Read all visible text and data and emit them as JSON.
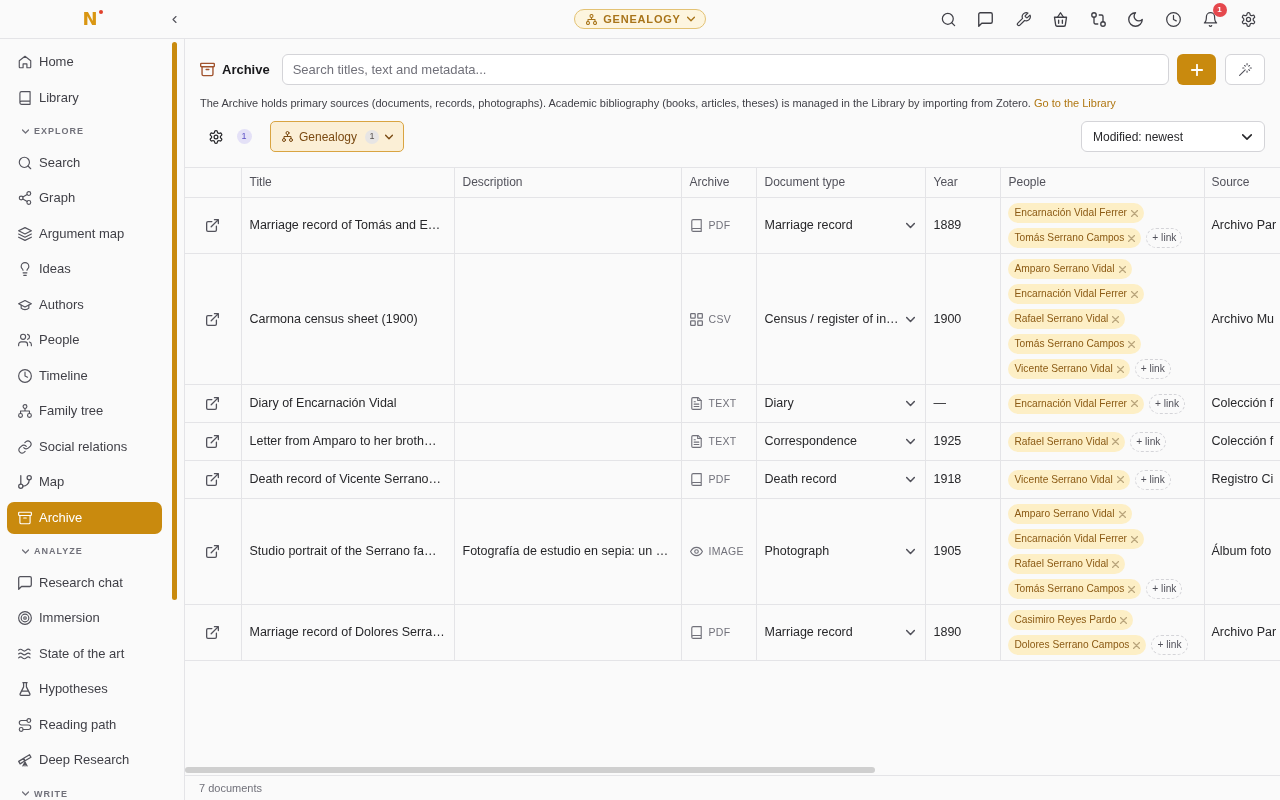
{
  "app": {
    "logo": "N",
    "workspace": "GENEALOGY",
    "notifications": "1"
  },
  "sidebar": {
    "sections": [
      {
        "items": [
          {
            "label": "Home",
            "selected": false
          },
          {
            "label": "Library",
            "selected": false
          }
        ]
      },
      {
        "heading": "EXPLORE",
        "expanded": true,
        "items": [
          {
            "label": "Search",
            "selected": false
          },
          {
            "label": "Graph",
            "selected": false
          },
          {
            "label": "Argument map",
            "selected": false
          },
          {
            "label": "Ideas",
            "selected": false
          },
          {
            "label": "Authors",
            "selected": false
          },
          {
            "label": "People",
            "selected": false
          },
          {
            "label": "Timeline",
            "selected": false
          },
          {
            "label": "Family tree",
            "selected": false
          },
          {
            "label": "Social relations",
            "selected": false
          },
          {
            "label": "Map",
            "selected": false
          },
          {
            "label": "Archive",
            "selected": true
          }
        ]
      },
      {
        "heading": "ANALYZE",
        "expanded": true,
        "items": [
          {
            "label": "Research chat",
            "selected": false
          },
          {
            "label": "Immersion",
            "selected": false
          },
          {
            "label": "State of the art",
            "selected": false
          },
          {
            "label": "Hypotheses",
            "selected": false
          },
          {
            "label": "Reading path",
            "selected": false
          },
          {
            "label": "Deep Research",
            "selected": false
          }
        ]
      },
      {
        "heading": "WRITE",
        "expanded": true
      }
    ]
  },
  "archive": {
    "title": "Archive",
    "search": {
      "placeholder": "Search titles, text and metadata..."
    },
    "description": "The Archive holds primary sources (documents, records, photographs). Academic bibliography (books, articles, theses) is managed in the Library by importing from Zotero.",
    "description_link": "Go to the Library",
    "active_filter_count": "1",
    "filter": {
      "label": "Genealogy",
      "count": "1"
    },
    "sort": "Modified: newest"
  },
  "table": {
    "columns": [
      "Title",
      "Description",
      "Archive",
      "Document type",
      "Year",
      "People",
      "Source"
    ],
    "rows": [
      {
        "title": "Marriage record of Tomás and E…",
        "format": {
          "kind": "pdf",
          "label": "PDF"
        },
        "document_type": "Marriage record",
        "year": "1889",
        "people": [
          "Encarnación Vidal Ferrer",
          "Tomás Serrano Campos"
        ],
        "link_action": "+ link",
        "source": "Archivo Par"
      },
      {
        "title": "Carmona census sheet (1900)",
        "format": {
          "kind": "csv",
          "label": "CSV"
        },
        "document_type": "Census / register of in…",
        "year": "1900",
        "people": [
          "Amparo Serrano Vidal",
          "Encarnación Vidal Ferrer",
          "Rafael Serrano Vidal",
          "Tomás Serrano Campos",
          "Vicente Serrano Vidal"
        ],
        "link_action": "+ link",
        "source": "Archivo Mu"
      },
      {
        "title": "Diary of Encarnación Vidal",
        "format": {
          "kind": "text",
          "label": "TEXT"
        },
        "document_type": "Diary",
        "year": "—",
        "people": [
          "Encarnación Vidal Ferrer"
        ],
        "link_action": "+ link",
        "source": "Colección f"
      },
      {
        "title": "Letter from Amparo to her broth…",
        "format": {
          "kind": "text",
          "label": "TEXT"
        },
        "document_type": "Correspondence",
        "year": "1925",
        "people": [
          "Rafael Serrano Vidal"
        ],
        "link_action": "+ link",
        "source": "Colección f"
      },
      {
        "title": "Death record of Vicente Serrano…",
        "format": {
          "kind": "pdf",
          "label": "PDF"
        },
        "document_type": "Death record",
        "year": "1918",
        "people": [
          "Vicente Serrano Vidal"
        ],
        "link_action": "+ link",
        "source": "Registro Ci"
      },
      {
        "title": "Studio portrait of the Serrano fa…",
        "description": "Fotografía de estudio en sepia: un …",
        "format": {
          "kind": "image",
          "label": "IMAGE"
        },
        "document_type": "Photograph",
        "year": "1905",
        "people": [
          "Amparo Serrano Vidal",
          "Encarnación Vidal Ferrer",
          "Rafael Serrano Vidal",
          "Tomás Serrano Campos"
        ],
        "link_action": "+ link",
        "source": "Álbum foto"
      },
      {
        "title": "Marriage record of Dolores Serra…",
        "format": {
          "kind": "pdf",
          "label": "PDF"
        },
        "document_type": "Marriage record",
        "year": "1890",
        "people": [
          "Casimiro Reyes Pardo",
          "Dolores Serrano Campos"
        ],
        "link_action": "+ link",
        "source": "Archivo Par"
      }
    ]
  },
  "footer": {
    "count": "7 documents"
  }
}
